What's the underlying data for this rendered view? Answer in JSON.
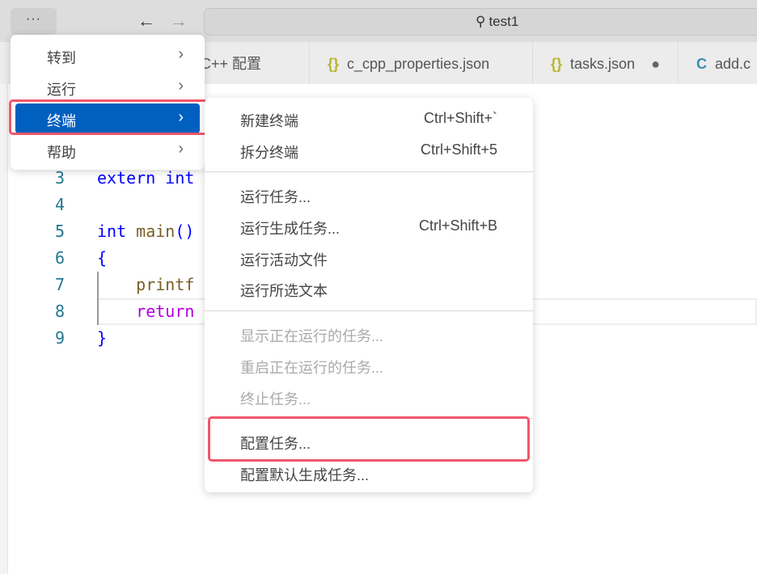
{
  "titlebar": {
    "more_label": "···",
    "back_icon": "arrow-left-icon",
    "forward_icon": "arrow-right-icon",
    "search_text": "test1"
  },
  "tabs": [
    {
      "label": "C/C++ 配置"
    },
    {
      "label": "c_cpp_properties.json",
      "icon": "{}"
    },
    {
      "label": "tasks.json",
      "icon": "{}",
      "dirty": "●"
    },
    {
      "label": "add.c",
      "icon": "C"
    }
  ],
  "editor": {
    "lines": [
      {
        "n": "3"
      },
      {
        "n": "4"
      },
      {
        "n": "5"
      },
      {
        "n": "6"
      },
      {
        "n": "7"
      },
      {
        "n": "8"
      },
      {
        "n": "9"
      }
    ],
    "code": {
      "l3a": "extern",
      "l3b": " int",
      "l5a": "int",
      "l5b": " main",
      "l5c": "()",
      "l6": "{",
      "l7": "    printf",
      "l8": "    return",
      "l9": "}"
    }
  },
  "menu": {
    "items": [
      {
        "label": "转到"
      },
      {
        "label": "运行"
      },
      {
        "label": "终端"
      },
      {
        "label": "帮助"
      }
    ]
  },
  "submenu": {
    "items": [
      {
        "label": "新建终端",
        "key": "Ctrl+Shift+`"
      },
      {
        "label": "拆分终端",
        "key": "Ctrl+Shift+5"
      },
      {
        "label": "运行任务..."
      },
      {
        "label": "运行生成任务...",
        "key": "Ctrl+Shift+B"
      },
      {
        "label": "运行活动文件"
      },
      {
        "label": "运行所选文本"
      },
      {
        "label": "显示正在运行的任务..."
      },
      {
        "label": "重启正在运行的任务..."
      },
      {
        "label": "终止任务..."
      },
      {
        "label": "配置任务..."
      },
      {
        "label": "配置默认生成任务..."
      }
    ]
  },
  "colors": {
    "accent": "#0060c0",
    "highlight": "#f0566a"
  }
}
